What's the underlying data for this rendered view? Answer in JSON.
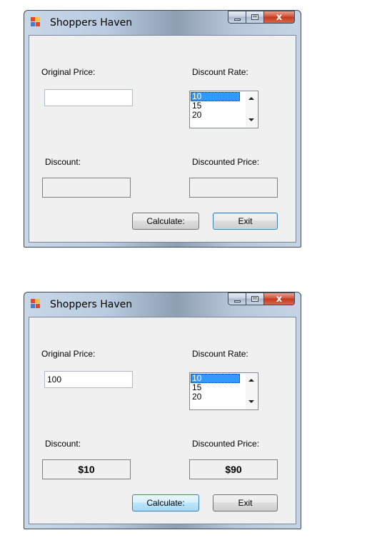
{
  "windows": [
    {
      "title": "Shoppers Haven",
      "original_price_label": "Original Price:",
      "original_price_value": "",
      "discount_rate_label": "Discount Rate:",
      "discount_rate_options": [
        "10",
        "15",
        "20"
      ],
      "discount_rate_selected": "10",
      "discount_label": "Discount:",
      "discount_value": "",
      "discounted_price_label": "Discounted Price:",
      "discounted_price_value": "",
      "calculate_label": "Calculate:",
      "exit_label": "Exit",
      "close_glyph": "x"
    },
    {
      "title": "Shoppers Haven",
      "original_price_label": "Original Price:",
      "original_price_value": "100",
      "discount_rate_label": "Discount Rate:",
      "discount_rate_options": [
        "10",
        "15",
        "20"
      ],
      "discount_rate_selected": "10",
      "discount_label": "Discount:",
      "discount_value": "$10",
      "discounted_price_label": "Discounted Price:",
      "discounted_price_value": "$90",
      "calculate_label": "Calculate:",
      "exit_label": "Exit",
      "close_glyph": "x"
    }
  ],
  "colors": {
    "selection": "#3399ff",
    "client_bg": "#f0f0f0",
    "close_button": "#c0391f"
  }
}
